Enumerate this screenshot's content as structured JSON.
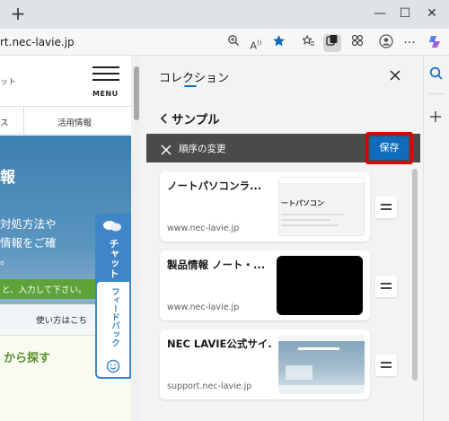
{
  "browser": {
    "new_tab_glyph": "+",
    "url": "rt.nec-lavie.jp",
    "win_min": "—",
    "win_max": "☐",
    "win_close": "✕"
  },
  "webpage": {
    "menu_label": "MENU",
    "header_fragment": "ット",
    "nav_left": "ス",
    "nav_right": "活用情報",
    "hero_title": "報",
    "hero_line1": "対処方法や",
    "hero_line2": "情報をご確",
    "hero_line3": "。",
    "search_hint": "と、入力して下さい。",
    "chat_label": "チャット",
    "feedback_label": "フィードバック",
    "howto_link": "使い方はこち",
    "section_heading": "から探す"
  },
  "collections": {
    "panel_title": "コレクション",
    "collection_name": "サンプル",
    "reorder_label": "順序の変更",
    "save_label": "保存",
    "items": [
      {
        "title": "ノートパソコンラ...",
        "site": "www.nec-lavie.jp"
      },
      {
        "title": "製品情報 ノート・...",
        "site": "www.nec-lavie.jp"
      },
      {
        "title": "NEC LAVIE公式サイ...",
        "site": "support.nec-lavie.jp"
      }
    ],
    "thumb1_text": "ートパソコン"
  },
  "colors": {
    "accent": "#0f6cbd",
    "highlight_border": "#e00000",
    "reorder_bar": "#4a4a4a",
    "hero_blue": "#3e7fb0",
    "section_green": "#5a8f2a"
  }
}
